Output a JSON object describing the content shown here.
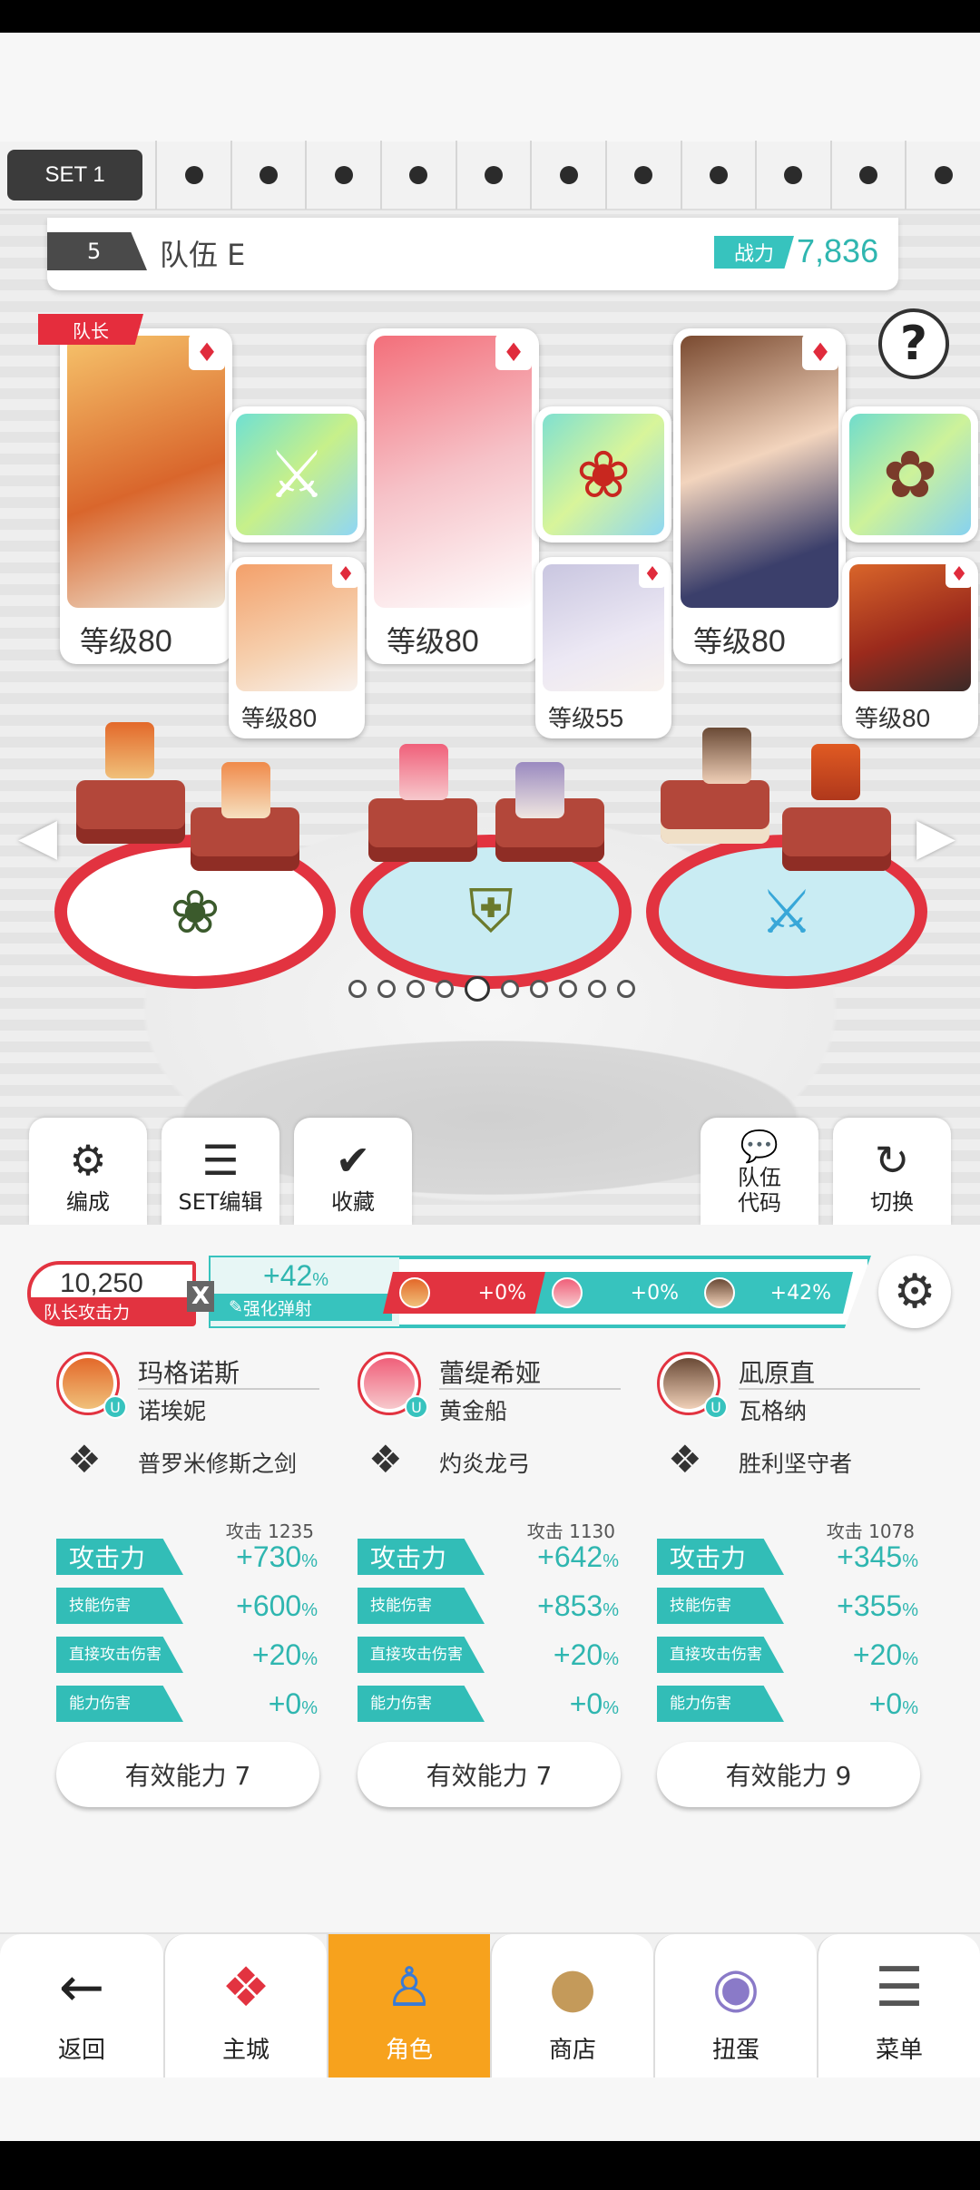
{
  "set_strip": {
    "active_label": "SET 1",
    "dot_count": 11
  },
  "team": {
    "number": "5",
    "name": "队伍 E",
    "power_label": "战力",
    "power_value": "7,836"
  },
  "help_label": "?",
  "leader_tag": "队长",
  "characters": [
    {
      "level_label": "等级",
      "level": "80",
      "sub_level_label": "等级",
      "sub_level": "80"
    },
    {
      "level_label": "等级",
      "level": "80",
      "sub_level_label": "等级",
      "sub_level": "55"
    },
    {
      "level_label": "等级",
      "level": "80",
      "sub_level_label": "等级",
      "sub_level": "80"
    }
  ],
  "actions": {
    "formation": "编成",
    "set_edit": "SET编辑",
    "favorite": "收藏",
    "team_code_line1": "队伍",
    "team_code_line2": "代码",
    "switch": "切换"
  },
  "summary": {
    "leader_attack_value": "10,250",
    "leader_attack_label": "队长攻击力",
    "multiplier": "X",
    "boost_value": "+42",
    "boost_unit": "%",
    "boost_label": "强化弹射",
    "chips": [
      "+0%",
      "+0%",
      "+42%"
    ]
  },
  "heroes": [
    {
      "name": "玛格诺斯",
      "partner": "诺埃妮",
      "weapon": "普罗米修斯之剑",
      "attack_top_label": "攻击",
      "attack_top_value": "1235",
      "stats": [
        {
          "label": "攻击力",
          "value": "+730",
          "unit": "%"
        },
        {
          "label": "技能伤害",
          "value": "+600",
          "unit": "%"
        },
        {
          "label": "直接攻击伤害",
          "value": "+20",
          "unit": "%"
        },
        {
          "label": "能力伤害",
          "value": "+0",
          "unit": "%"
        }
      ],
      "ability": "有效能力 7"
    },
    {
      "name": "蕾缇希娅",
      "partner": "黄金船",
      "weapon": "灼炎龙弓",
      "attack_top_label": "攻击",
      "attack_top_value": "1130",
      "stats": [
        {
          "label": "攻击力",
          "value": "+642",
          "unit": "%"
        },
        {
          "label": "技能伤害",
          "value": "+853",
          "unit": "%"
        },
        {
          "label": "直接攻击伤害",
          "value": "+20",
          "unit": "%"
        },
        {
          "label": "能力伤害",
          "value": "+0",
          "unit": "%"
        }
      ],
      "ability": "有效能力 7"
    },
    {
      "name": "凪原直",
      "partner": "瓦格纳",
      "weapon": "胜利坚守者",
      "attack_top_label": "攻击",
      "attack_top_value": "1078",
      "stats": [
        {
          "label": "攻击力",
          "value": "+345",
          "unit": "%"
        },
        {
          "label": "技能伤害",
          "value": "+355",
          "unit": "%"
        },
        {
          "label": "直接攻击伤害",
          "value": "+20",
          "unit": "%"
        },
        {
          "label": "能力伤害",
          "value": "+0",
          "unit": "%"
        }
      ],
      "ability": "有效能力 9"
    }
  ],
  "nav": {
    "back": "返回",
    "town": "主城",
    "character": "角色",
    "shop": "商店",
    "gacha": "扭蛋",
    "menu": "菜单",
    "active": "character"
  },
  "colors": {
    "accent_teal": "#37c3be",
    "accent_red": "#e23340",
    "nav_active": "#f7a21d"
  }
}
